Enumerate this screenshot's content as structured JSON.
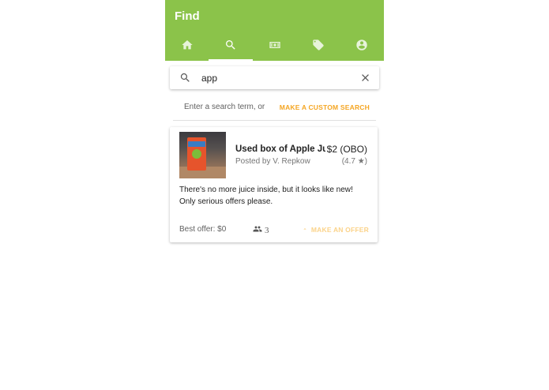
{
  "app": {
    "title": "Find",
    "accent_color": "#8bc34a",
    "link_color": "#f5a623"
  },
  "tabs": [
    {
      "name": "home",
      "icon": "home-icon",
      "active": false
    },
    {
      "name": "search",
      "icon": "search-icon",
      "active": true
    },
    {
      "name": "money",
      "icon": "money-icon",
      "active": false
    },
    {
      "name": "tags",
      "icon": "tags-icon",
      "active": false
    },
    {
      "name": "account",
      "icon": "account-icon",
      "active": false
    }
  ],
  "search": {
    "value": "app",
    "placeholder": ""
  },
  "hint": {
    "text": "Enter a search term, or",
    "custom_search_label": "MAKE A CUSTOM SEARCH"
  },
  "result": {
    "title": "Used box of Apple Juice",
    "poster": "Posted by V. Repkow",
    "price": "$2 (OBO)",
    "rating": "(4.7 ★)",
    "description": "There's no more juice inside, but it looks like new! Only serious offers please.",
    "best_offer": "Best offer: $0",
    "offer_count": "3",
    "make_offer_label": "MAKE AN OFFER"
  }
}
